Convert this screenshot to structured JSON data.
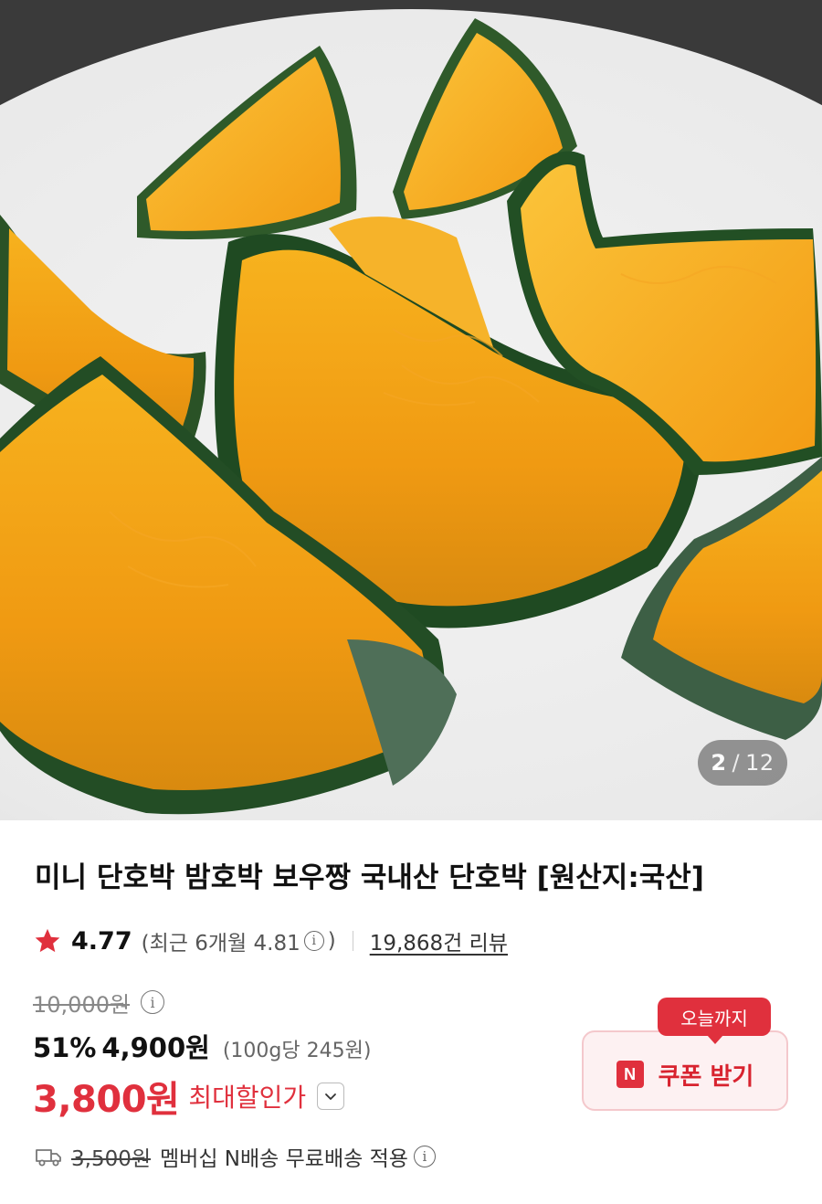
{
  "gallery": {
    "current": "2",
    "separator": "/",
    "total": "12"
  },
  "product": {
    "title": "미니 단호박 밤호박 보우짱 국내산 단호박 [원산지:국산]"
  },
  "rating": {
    "score": "4.77",
    "recent_prefix": "(최근 6개월 4.81",
    "recent_suffix": ")",
    "reviews": "19,868건 리뷰"
  },
  "price": {
    "original": "10,000원",
    "discount_rate": "51%",
    "sale": "4,900원",
    "unit_price": "(100g당 245원)",
    "max_discount_price": "3,800원",
    "max_discount_label": "최대할인가"
  },
  "shipping": {
    "strike_fee": "3,500원",
    "text": "멤버십 N배송 무료배송 적용"
  },
  "coupon": {
    "badge": "오늘까지",
    "icon_letter": "N",
    "label": "쿠폰 받기"
  },
  "colors": {
    "accent_red": "#e0303d",
    "coupon_bg": "#fdf1f2"
  },
  "icons": [
    "star-icon",
    "info-icon",
    "chevron-down-icon",
    "truck-icon",
    "naver-n-icon"
  ]
}
